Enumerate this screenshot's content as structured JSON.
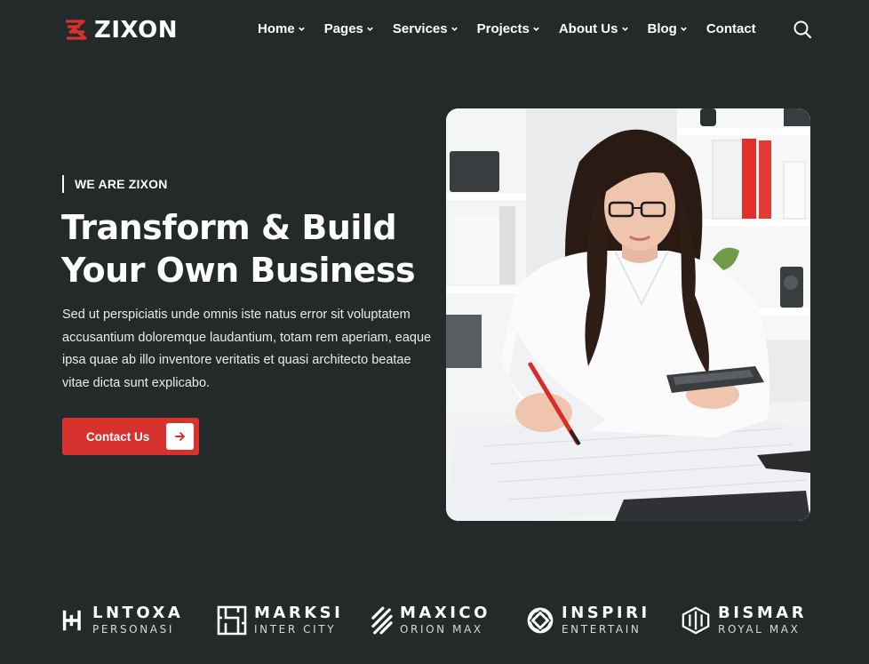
{
  "brand": {
    "name": "ZIXON",
    "accent_color": "#d8322f",
    "background_color": "#242a29"
  },
  "nav": {
    "items": [
      {
        "label": "Home",
        "has_dropdown": true
      },
      {
        "label": "Pages",
        "has_dropdown": true
      },
      {
        "label": "Services",
        "has_dropdown": true
      },
      {
        "label": "Projects",
        "has_dropdown": true
      },
      {
        "label": "About Us",
        "has_dropdown": true
      },
      {
        "label": "Blog",
        "has_dropdown": true
      },
      {
        "label": "Contact",
        "has_dropdown": false
      }
    ],
    "search_icon": "search-icon"
  },
  "hero": {
    "eyebrow": "WE ARE ZIXON",
    "title_line1": "Transform & Build",
    "title_line2": "Your Own Business",
    "description": "Sed ut perspiciatis unde omnis iste natus error sit voluptatem accusantium doloremque laudantium, totam rem aperiam, eaque ipsa quae ab illo inventore veritatis et quasi architecto beatae vitae dicta sunt explicabo.",
    "cta_label": "Contact Us",
    "cta_icon": "arrow-right-icon",
    "image_icon": "woman-working-with-calculator-photo"
  },
  "partners": [
    {
      "name": "LNTOXA",
      "tagline": "PERSONASI",
      "icon": "lntoxa-logo-icon"
    },
    {
      "name": "MARKSI",
      "tagline": "INTER CITY",
      "icon": "marksi-logo-icon"
    },
    {
      "name": "MAXICO",
      "tagline": "ORION MAX",
      "icon": "maxico-logo-icon"
    },
    {
      "name": "INSPIRI",
      "tagline": "ENTERTAIN",
      "icon": "inspiri-logo-icon"
    },
    {
      "name": "BISMAR",
      "tagline": "ROYAL MAX",
      "icon": "bismar-logo-icon"
    }
  ]
}
